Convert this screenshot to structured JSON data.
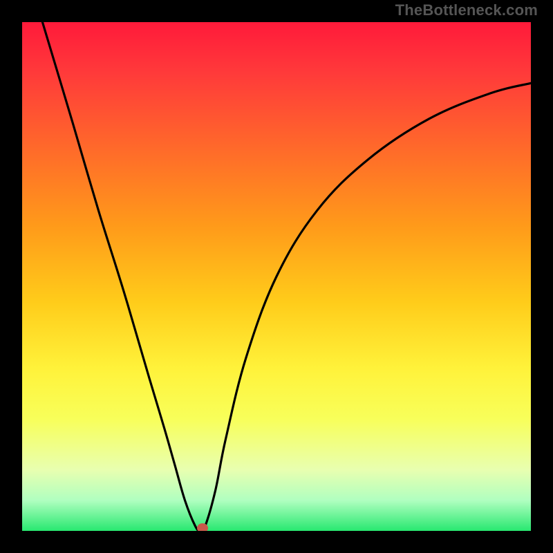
{
  "watermark": "TheBottleneck.com",
  "chart_data": {
    "type": "line",
    "title": "",
    "xlabel": "",
    "ylabel": "",
    "xlim": [
      0,
      100
    ],
    "ylim": [
      0,
      100
    ],
    "series": [
      {
        "name": "curve",
        "x": [
          4,
          10,
          15,
          20,
          25,
          28,
          30,
          32,
          34,
          35,
          36,
          38,
          40,
          44,
          50,
          58,
          68,
          80,
          92,
          100
        ],
        "y": [
          100,
          80,
          63,
          47,
          30,
          20,
          13,
          6,
          1,
          0,
          1,
          8,
          18,
          34,
          50,
          63,
          73,
          81,
          86,
          88
        ]
      }
    ],
    "marker": {
      "x": 35.5,
      "y": 0.5
    },
    "background_gradient": {
      "top": "#ff1a3a",
      "bottom": "#28e870"
    }
  }
}
